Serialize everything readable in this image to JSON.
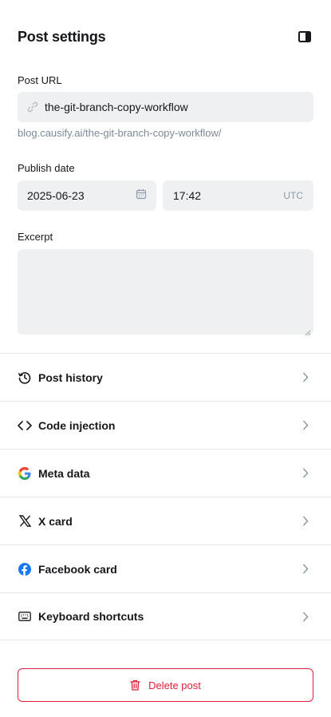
{
  "header": {
    "title": "Post settings",
    "toggle_icon": "panel-toggle-icon"
  },
  "post_url": {
    "label": "Post URL",
    "value": "the-git-branch-copy-workflow",
    "hint": "blog.causify.ai/the-git-branch-copy-workflow/",
    "icon": "link-icon"
  },
  "publish_date": {
    "label": "Publish date",
    "date": "2025-06-23",
    "time": "17:42",
    "timezone": "UTC",
    "date_icon": "calendar-icon"
  },
  "excerpt": {
    "label": "Excerpt",
    "value": ""
  },
  "menu": {
    "items": [
      {
        "label": "Post history",
        "icon": "history-icon"
      },
      {
        "label": "Code injection",
        "icon": "code-icon"
      },
      {
        "label": "Meta data",
        "icon": "google-icon"
      },
      {
        "label": "X card",
        "icon": "x-icon"
      },
      {
        "label": "Facebook card",
        "icon": "facebook-icon"
      },
      {
        "label": "Keyboard shortcuts",
        "icon": "keyboard-icon"
      }
    ]
  },
  "delete": {
    "label": "Delete post",
    "icon": "trash-icon"
  },
  "colors": {
    "danger": "#e0203a",
    "field_bg": "#eff0f1",
    "text": "#15171a",
    "muted": "#7c8b9a",
    "divider": "#e6e9eb"
  }
}
